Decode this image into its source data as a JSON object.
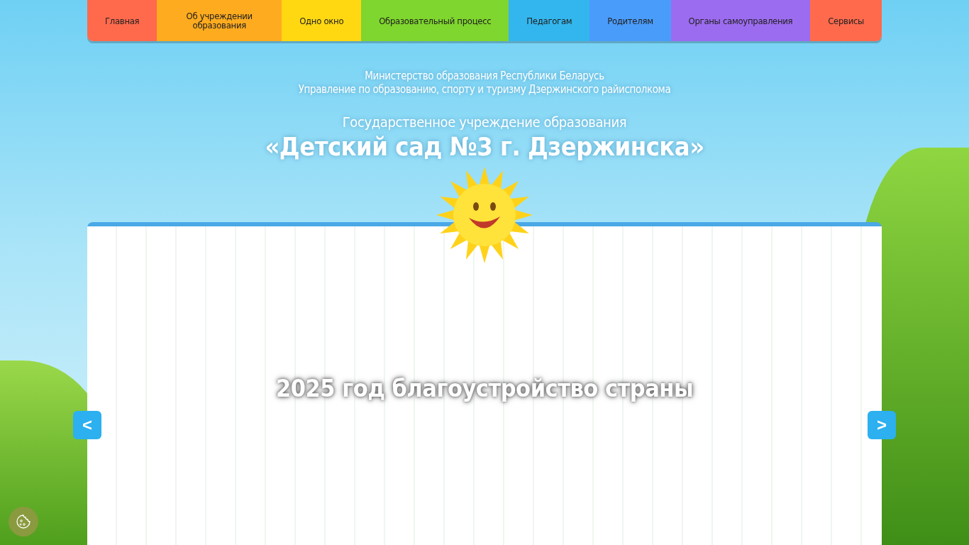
{
  "menu": [
    {
      "label": "Главная",
      "color": "#ff6a4d"
    },
    {
      "label": "Об учреждении образования",
      "color": "#ffab1f"
    },
    {
      "label": "Одно окно",
      "color": "#ffd812"
    },
    {
      "label": "Образовательный процесс",
      "color": "#7fd62e"
    },
    {
      "label": "Педагогам",
      "color": "#33b6ee"
    },
    {
      "label": "Родителям",
      "color": "#4a9cfb"
    },
    {
      "label": "Органы самоуправления",
      "color": "#9c6cf0"
    },
    {
      "label": "Сервисы",
      "color": "#ff6a4d"
    }
  ],
  "header": {
    "ministry": "Министерство образования Республики Беларусь",
    "department": "Управление по образованию, спорту и туризму Дзержинского райисполкома",
    "institution_type": "Государственное учреждение образования",
    "institution_name": "«Детский сад №3 г. Дзержинска»"
  },
  "slider": {
    "caption": "2025 год благоустройство страны",
    "prev": "<",
    "next": ">"
  }
}
